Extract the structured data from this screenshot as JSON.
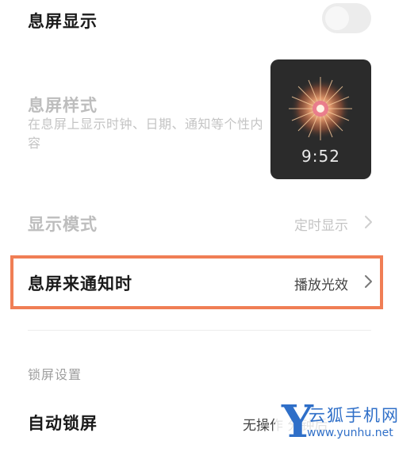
{
  "aod_display": {
    "title": "息屏显示",
    "toggle_state": "off"
  },
  "aod_style": {
    "title": "息屏样式",
    "subtitle": "在息屏上显示时钟、日期、通知等个性内容",
    "preview_time": "9:52"
  },
  "display_mode": {
    "title": "显示模式",
    "value": "定时显示"
  },
  "aod_notification": {
    "title": "息屏来通知时",
    "value": "播放光效"
  },
  "lockscreen_section": {
    "header": "锁屏设置"
  },
  "auto_lock": {
    "title": "自动锁屏",
    "value": "无操作 分钟后"
  },
  "watermark": {
    "letter": "Y",
    "name": "云狐手机网",
    "url": "www.yunhu.net",
    "color": "#2f6fc8"
  },
  "colors": {
    "highlight_border": "#f07e55",
    "disabled_text": "#bdbdbd",
    "preview_bg": "#2b2b2b"
  },
  "icons": {
    "chevron": "chevron-right-icon",
    "toggle": "toggle-switch",
    "preview_art": "firework-clock-art"
  }
}
